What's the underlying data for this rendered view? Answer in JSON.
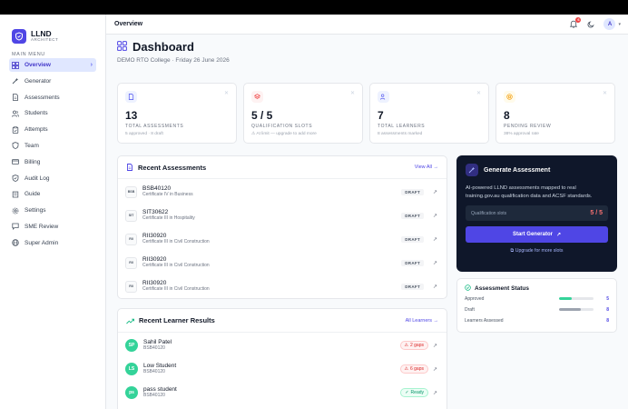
{
  "brand": {
    "name": "LLND",
    "sub": "ARCHITECT"
  },
  "sidebar": {
    "section_label": "MAIN MENU",
    "items": [
      {
        "label": "Overview",
        "icon": "grid-icon",
        "active": true
      },
      {
        "label": "Generator",
        "icon": "wand-icon"
      },
      {
        "label": "Assessments",
        "icon": "document-icon"
      },
      {
        "label": "Students",
        "icon": "users-icon"
      },
      {
        "label": "Attempts",
        "icon": "clipboard-icon"
      },
      {
        "label": "Team",
        "icon": "shield-icon"
      },
      {
        "label": "Billing",
        "icon": "credit-card-icon"
      },
      {
        "label": "Audit Log",
        "icon": "shield-check-icon"
      },
      {
        "label": "Guide",
        "icon": "book-icon"
      },
      {
        "label": "Settings",
        "icon": "gear-icon"
      },
      {
        "label": "SME Review",
        "icon": "chat-icon"
      },
      {
        "label": "Super Admin",
        "icon": "globe-icon"
      }
    ]
  },
  "header": {
    "title": "Overview",
    "notification_count": "6",
    "avatar_initial": "A"
  },
  "page": {
    "title": "Dashboard",
    "subtitle": "DEMO RTO College · Friday 26 June 2026"
  },
  "stats": [
    {
      "value": "13",
      "label": "TOTAL ASSESSMENTS",
      "note": "5 approved · 8 draft",
      "color": "#6366f1"
    },
    {
      "value": "5 / 5",
      "label": "QUALIFICATION SLOTS",
      "note": "⚠ At limit — upgrade to add more",
      "color": "#ef4444"
    },
    {
      "value": "7",
      "label": "TOTAL LEARNERS",
      "note": "8 assessments marked",
      "color": "#6366f1"
    },
    {
      "value": "8",
      "label": "PENDING REVIEW",
      "note": "38% approval rate",
      "color": "#f59e0b"
    }
  ],
  "recent_assessments": {
    "title": "Recent Assessments",
    "link": "View All",
    "rows": [
      {
        "code_short": "BSB",
        "code": "BSB40120",
        "name": "Certificate IV in Business",
        "status": "DRAFT"
      },
      {
        "code_short": "SIT",
        "code": "SIT30622",
        "name": "Certificate III in Hospitality",
        "status": "DRAFT"
      },
      {
        "code_short": "RII",
        "code": "RII30920",
        "name": "Certificate III in Civil Construction",
        "status": "DRAFT"
      },
      {
        "code_short": "RII",
        "code": "RII30920",
        "name": "Certificate III in Civil Construction",
        "status": "DRAFT"
      },
      {
        "code_short": "RII",
        "code": "RII30920",
        "name": "Certificate III in Civil Construction",
        "status": "DRAFT"
      }
    ]
  },
  "learner_results": {
    "title": "Recent Learner Results",
    "link": "All Learners",
    "rows": [
      {
        "initials": "SP",
        "name": "Sahil Patel",
        "code": "BSB40120",
        "badge": "2 gaps",
        "badge_type": "red"
      },
      {
        "initials": "LS",
        "name": "Low Student",
        "code": "BSB40120",
        "badge": "6 gaps",
        "badge_type": "red"
      },
      {
        "initials": "ps",
        "name": "pass student",
        "code": "BSB40120",
        "badge": "Ready",
        "badge_type": "green"
      }
    ]
  },
  "generate": {
    "title": "Generate Assessment",
    "description": "AI-powered LLND assessments mapped to real training.gov.au qualification data and ACSF standards.",
    "slots_label": "Qualification slots",
    "slots_value": "5 / 5",
    "button": "Start Generator",
    "upgrade": "Upgrade for more slots"
  },
  "assessment_status": {
    "title": "Assessment Status",
    "rows": [
      {
        "label": "Approved",
        "value": "5",
        "fraction": 0.38,
        "color": "#34d399"
      },
      {
        "label": "Draft",
        "value": "8",
        "fraction": 0.62,
        "color": "#9ca3af"
      },
      {
        "label": "Learners Assessed",
        "value": "8",
        "fraction": 0,
        "color": "#6366f1"
      }
    ]
  }
}
